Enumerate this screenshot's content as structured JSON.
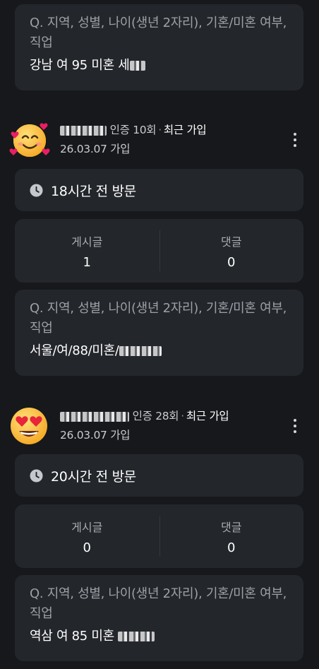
{
  "top_card": {
    "question": "Q. 지역, 성별, 나이(생년 2자리), 기혼/미혼 여부, 직업",
    "answer": "강남 여 95 미혼 ",
    "answer_tail": "세"
  },
  "members": [
    {
      "avatar_icon": "smiling-face-with-hearts-icon",
      "verify_label": "인증 10회",
      "recent_label": "최근 가입",
      "joined": "26.03.07 가입",
      "visit": "18시간 전 방문",
      "posts_label": "게시글",
      "posts_value": "1",
      "comments_label": "댓글",
      "comments_value": "0",
      "question": "Q. 지역, 성별, 나이(생년 2자리), 기혼/미혼 여부, 직업",
      "answer": "서울/여/88/미혼/"
    },
    {
      "avatar_icon": "heart-eyes-face-icon",
      "verify_label": "인증 28회",
      "recent_label": "최근 가입",
      "joined": "26.03.07 가입",
      "visit": "20시간 전 방문",
      "posts_label": "게시글",
      "posts_value": "0",
      "comments_label": "댓글",
      "comments_value": "0",
      "question": "Q. 지역, 성별, 나이(생년 2자리), 기혼/미혼 여부, 직업",
      "answer": "역삼 여 85 미혼"
    }
  ],
  "colors": {
    "background": "#16181b",
    "card": "#23262b",
    "muted_text": "#9da1a7",
    "primary_text": "#ffffff"
  }
}
